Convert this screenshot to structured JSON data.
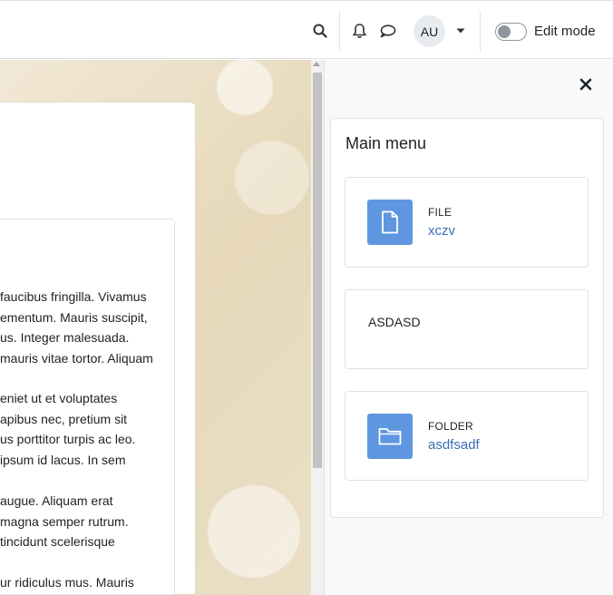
{
  "navbar": {
    "avatar_initials": "AU",
    "edit_mode_label": "Edit mode"
  },
  "content": {
    "paragraphs": [
      [
        "faucibus fringilla. Vivamus",
        "ementum. Mauris suscipit,",
        "us. Integer malesuada.",
        "mauris vitae tortor. Aliquam"
      ],
      [
        "eniet ut et voluptates",
        "apibus nec, pretium sit",
        "us porttitor turpis ac leo.",
        "ipsum id lacus. In sem"
      ],
      [
        "augue. Aliquam erat",
        "magna semper rutrum.",
        "tincidunt scelerisque"
      ],
      [
        "ur ridiculus mus. Mauris"
      ]
    ]
  },
  "drawer": {
    "title": "Main menu",
    "activities": [
      {
        "type": "FILE",
        "name": "xczv",
        "icon": "file-icon"
      },
      {
        "text": "ASDASD"
      },
      {
        "type": "FOLDER",
        "name": "asdfsadf",
        "icon": "folder-icon"
      }
    ]
  },
  "colors": {
    "accent": "#5f96e0",
    "link": "#3a6fb7"
  }
}
